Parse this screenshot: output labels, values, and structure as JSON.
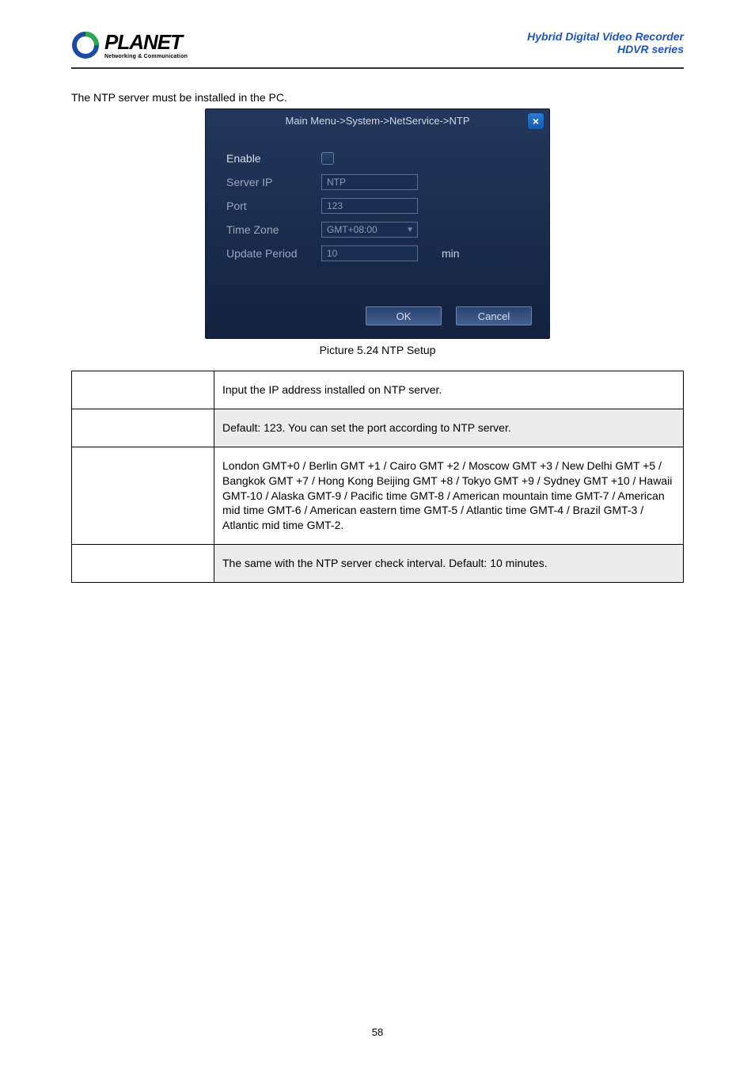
{
  "header": {
    "logo_text": "PLANET",
    "logo_sub": "Networking & Communication",
    "right_line1": "Hybrid Digital Video Recorder",
    "right_line2": "HDVR series"
  },
  "intro": "The NTP server must be installed in the PC.",
  "dialog": {
    "title": "Main Menu->System->NetService->NTP",
    "close": "×",
    "rows": {
      "enable_label": "Enable",
      "server_label": "Server IP",
      "server_value": "NTP",
      "port_label": "Port",
      "port_value": "123",
      "tz_label": "Time Zone",
      "tz_value": "GMT+08:00",
      "update_label": "Update Period",
      "update_value": "10",
      "update_unit": "min"
    },
    "ok": "OK",
    "cancel": "Cancel"
  },
  "caption": "Picture 5.24 NTP Setup",
  "table": {
    "r1v": "Input the IP address installed on NTP server.",
    "r2v": "Default: 123. You can set the port according to NTP server.",
    "r3v": "London GMT+0 / Berlin GMT +1 / Cairo GMT +2 / Moscow GMT +3 / New Delhi GMT +5 / Bangkok GMT +7 / Hong Kong Beijing GMT +8 / Tokyo GMT +9 / Sydney GMT +10 / Hawaii GMT-10 / Alaska GMT-9 / Pacific time GMT-8 / American mountain time GMT-7 / American mid time GMT-6 / American eastern time GMT-5 / Atlantic time GMT-4 / Brazil GMT-3 / Atlantic mid time GMT-2.",
    "r4v": "The same with the NTP server check interval. Default: 10 minutes."
  },
  "page_num": "58"
}
